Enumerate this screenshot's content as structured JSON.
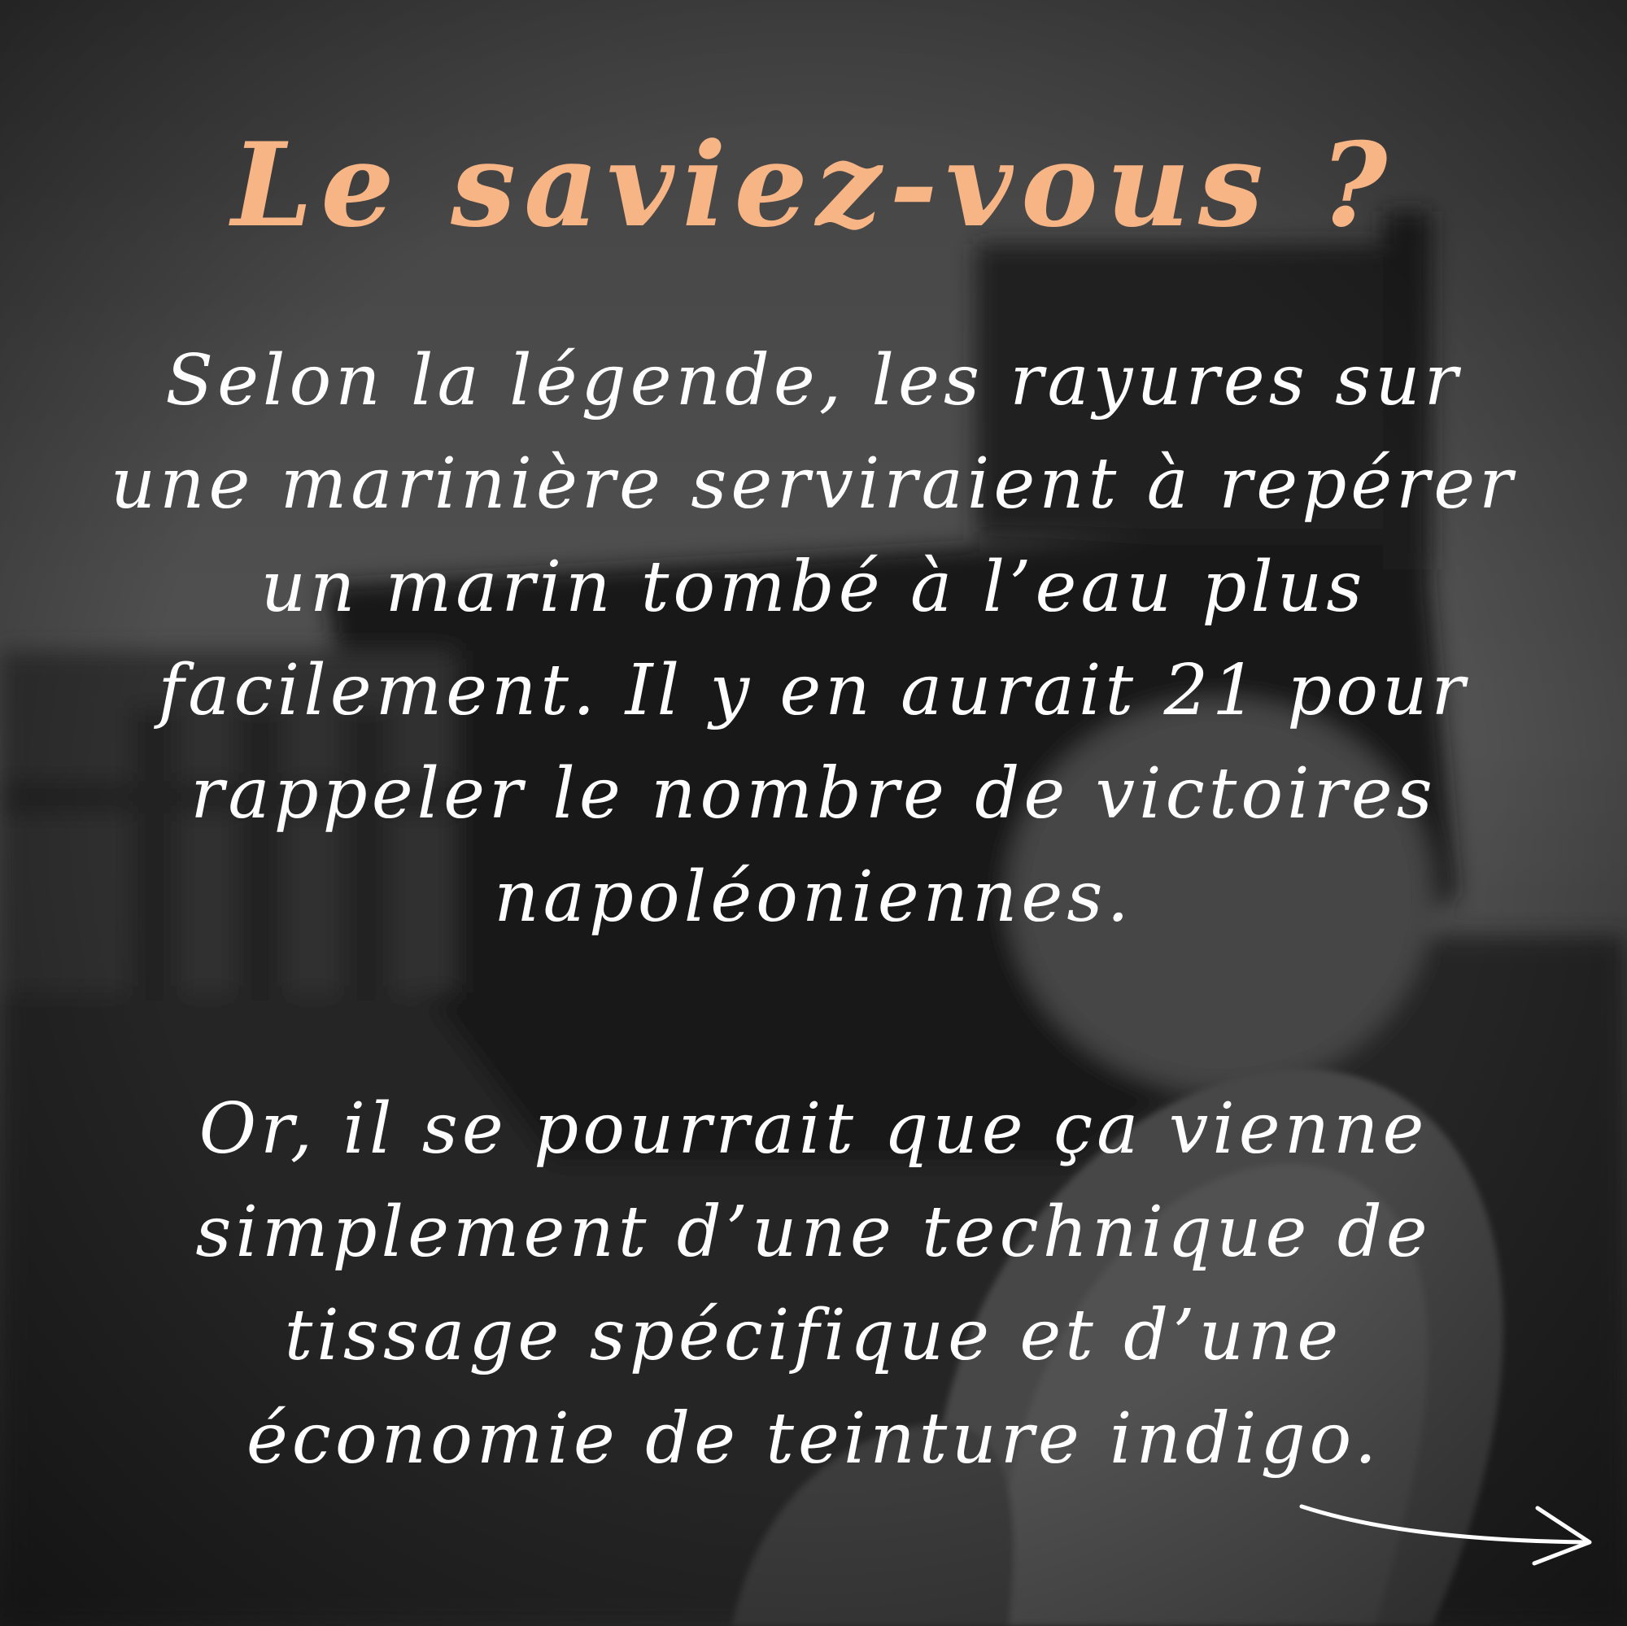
{
  "heading": {
    "title": "Le saviez-vous ?"
  },
  "paragraph_1": {
    "lines": [
      "Selon la légende, les rayures sur",
      "une marinière serviraient à repérer",
      "un marin tombé à l’eau plus",
      "facilement. Il y en aurait 21 pour",
      "rappeler le nombre de victoires",
      "napoléoniennes."
    ]
  },
  "paragraph_2": {
    "lines": [
      "Or, il se pourrait que ça vienne",
      "simplement  d’une technique de",
      "tissage spécifique et d’une",
      "économie de teinture indigo."
    ]
  },
  "colors": {
    "title": "#f7b485",
    "body_text": "#ffffff",
    "overlay": "#1e1e1e"
  },
  "icons": {
    "next": "arrow-right-icon"
  }
}
